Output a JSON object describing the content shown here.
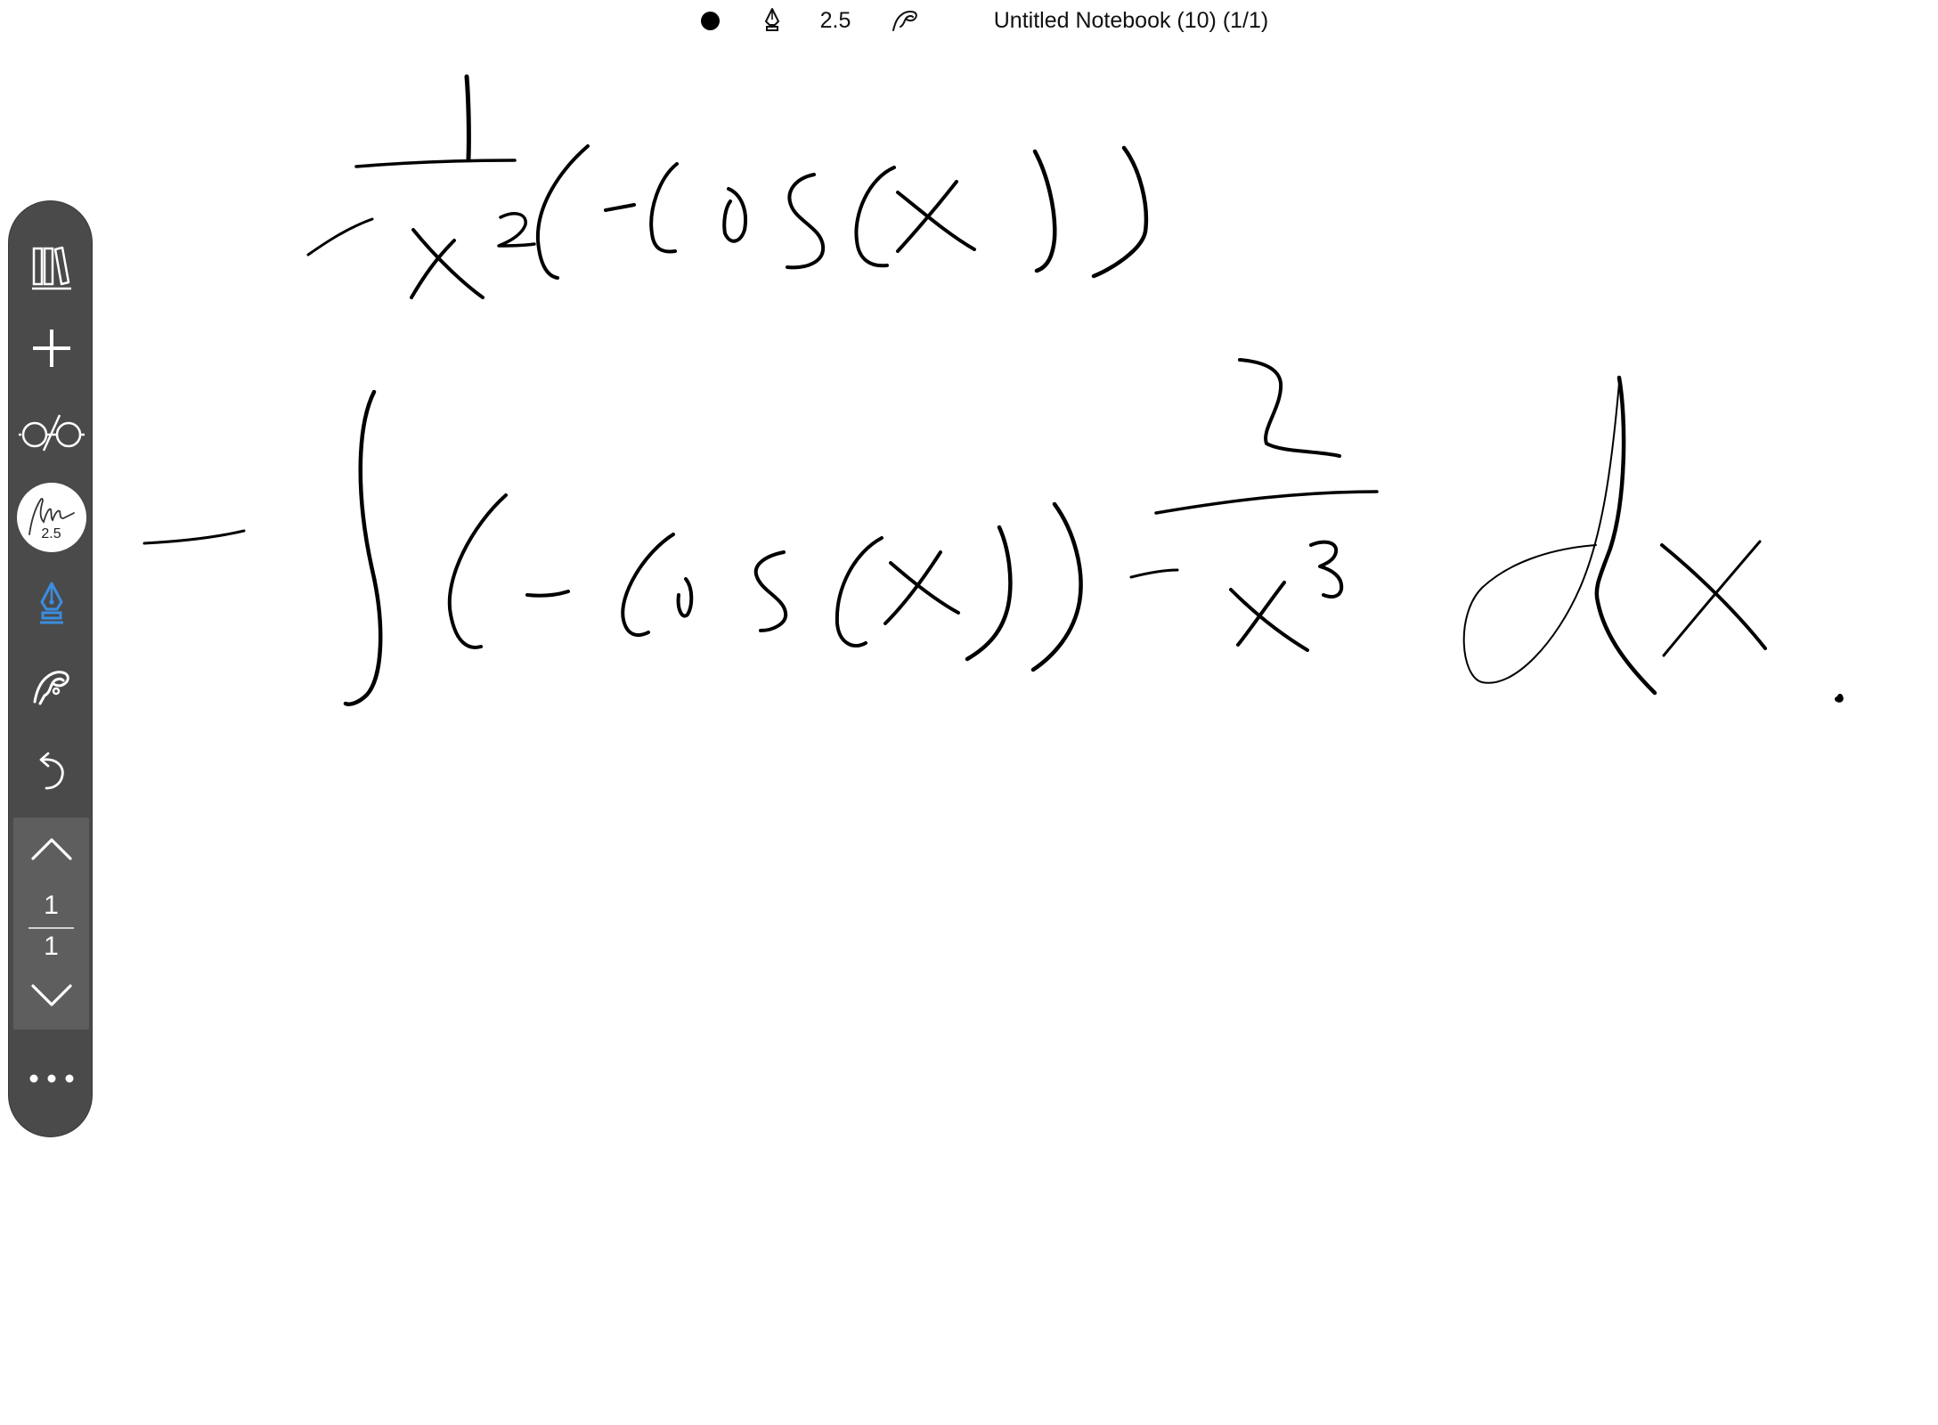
{
  "topbar": {
    "pen_size": "2.5",
    "title": "Untitled Notebook (10) (1/1)",
    "ink_color": "#000000",
    "icons": [
      "color-dot-icon",
      "fountain-pen-icon",
      "touch-hand-icon"
    ]
  },
  "toolbar": {
    "background": "#4a4a4a",
    "active_color": "#3b8de0",
    "pen_preview_size": "2.5",
    "icons": [
      "library-icon",
      "add-icon",
      "read-mode-icon",
      "pen-preview-icon",
      "fountain-pen-icon",
      "touch-hand-icon",
      "undo-icon",
      "chevron-up-icon",
      "chevron-down-icon",
      "more-icon"
    ],
    "pager": {
      "current": "1",
      "total": "1"
    }
  }
}
